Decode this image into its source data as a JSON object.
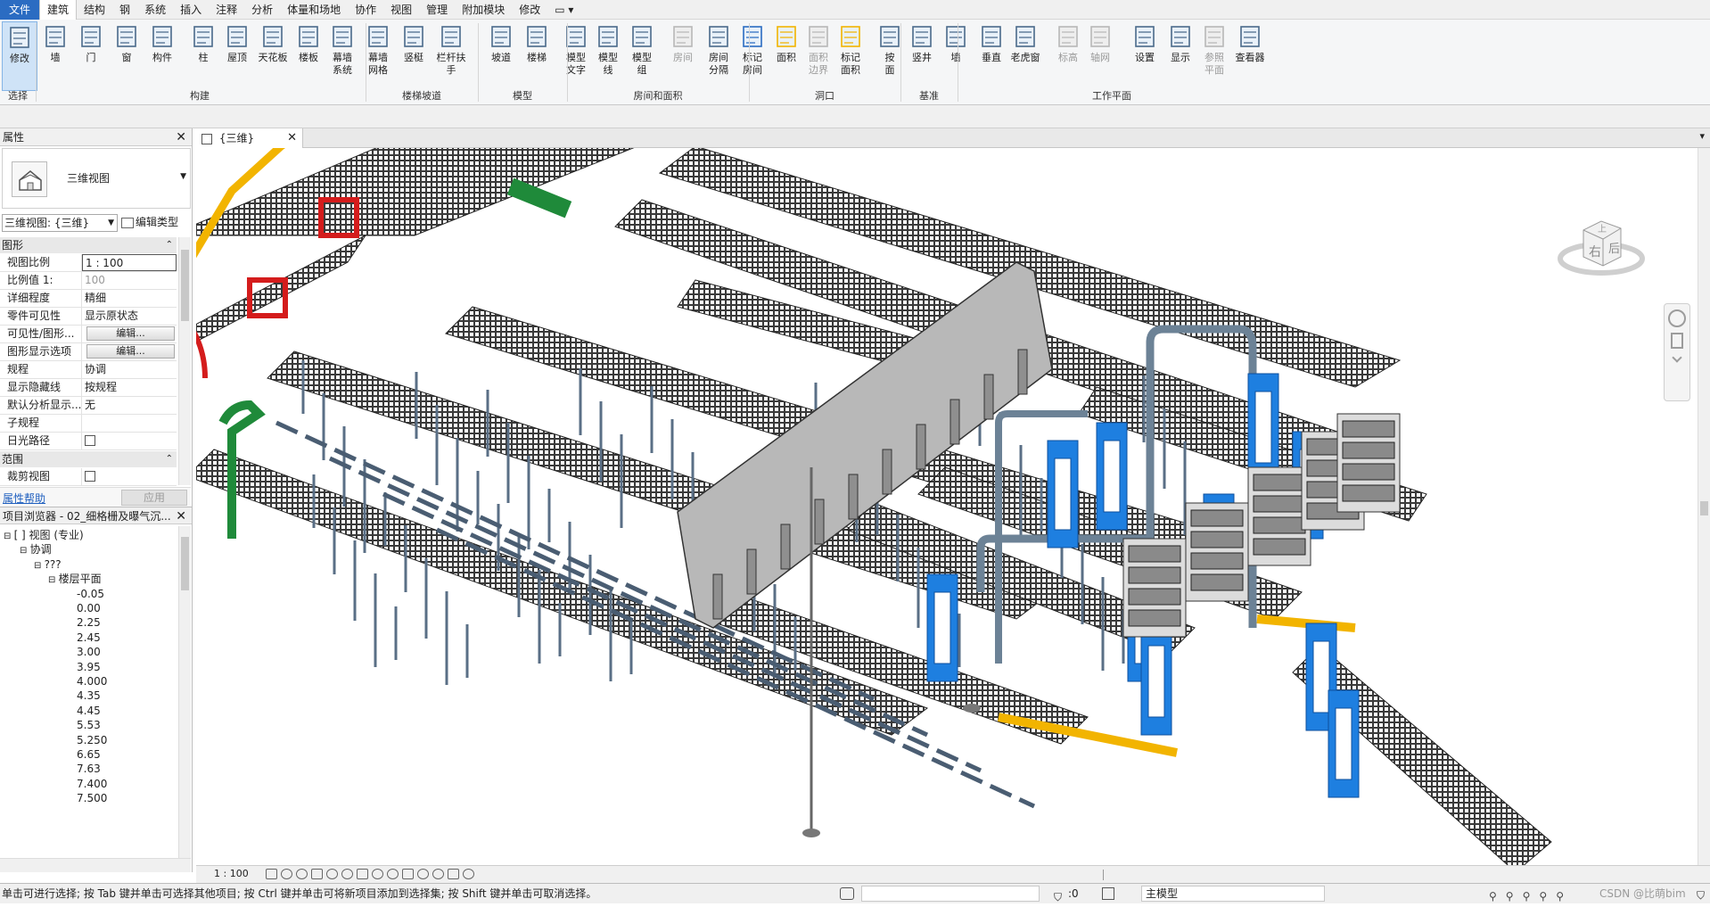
{
  "menubar": {
    "items": [
      "文件",
      "建筑",
      "结构",
      "钢",
      "系统",
      "插入",
      "注释",
      "分析",
      "体量和场地",
      "协作",
      "视图",
      "管理",
      "附加模块",
      "修改"
    ],
    "active_index": 1,
    "extra_dropdown": "▭ ▾"
  },
  "ribbon": {
    "buttons": [
      {
        "label": "修改",
        "icon": "cursor-arrow-icon",
        "active": true
      },
      {
        "label": "墙",
        "icon": "wall-icon"
      },
      {
        "label": "门",
        "icon": "door-icon"
      },
      {
        "label": "窗",
        "icon": "window-icon"
      },
      {
        "label": "构件",
        "icon": "component-icon"
      },
      {
        "label": "柱",
        "icon": "column-icon"
      },
      {
        "label": "屋顶",
        "icon": "roof-icon"
      },
      {
        "label": "天花板",
        "icon": "ceiling-icon"
      },
      {
        "label": "楼板",
        "icon": "floor-icon"
      },
      {
        "label": "幕墙\n系统",
        "icon": "curtain-system-icon"
      },
      {
        "label": "幕墙\n网格",
        "icon": "curtain-grid-icon"
      },
      {
        "label": "竖梃",
        "icon": "mullion-icon"
      },
      {
        "label": "栏杆扶手",
        "icon": "railing-icon"
      },
      {
        "label": "坡道",
        "icon": "ramp-icon"
      },
      {
        "label": "楼梯",
        "icon": "stair-icon"
      },
      {
        "label": "模型\n文字",
        "icon": "model-text-icon"
      },
      {
        "label": "模型\n线",
        "icon": "model-line-icon"
      },
      {
        "label": "模型\n组",
        "icon": "model-group-icon"
      },
      {
        "label": "房间",
        "icon": "room-icon",
        "dim": true
      },
      {
        "label": "房间\n分隔",
        "icon": "room-separator-icon"
      },
      {
        "label": "标记\n房间",
        "icon": "tag-room-icon"
      },
      {
        "label": "面积",
        "icon": "area-icon"
      },
      {
        "label": "面积\n边界",
        "icon": "area-boundary-icon",
        "dim": true
      },
      {
        "label": "标记\n面积",
        "icon": "tag-area-icon"
      },
      {
        "label": "按\n面",
        "icon": "by-face-icon"
      },
      {
        "label": "竖井",
        "icon": "shaft-icon"
      },
      {
        "label": "墙",
        "icon": "wall-opening-icon"
      },
      {
        "label": "垂直",
        "icon": "vertical-opening-icon"
      },
      {
        "label": "老虎窗",
        "icon": "dormer-icon"
      },
      {
        "label": "标高",
        "icon": "level-icon",
        "dim": true
      },
      {
        "label": "轴网",
        "icon": "grid-icon",
        "dim": true
      },
      {
        "label": "设置",
        "icon": "set-workplane-icon"
      },
      {
        "label": "显示",
        "icon": "show-workplane-icon"
      },
      {
        "label": "参照\n平面",
        "icon": "ref-plane-icon",
        "dim": true
      },
      {
        "label": "查看器",
        "icon": "viewer-icon"
      }
    ],
    "groups": [
      "选择",
      "构建",
      "楼梯坡道",
      "模型",
      "房间和面积",
      "洞口",
      "基准",
      "工作平面"
    ]
  },
  "properties": {
    "title": "属性",
    "type_name": "三维视图",
    "view_selector": "三维视图: {三维}",
    "edit_type": "编辑类型",
    "section_graphics": "图形",
    "rows": [
      {
        "k": "视图比例",
        "v": "1 : 100"
      },
      {
        "k": "比例值 1:",
        "v": "100"
      },
      {
        "k": "详细程度",
        "v": "精细"
      },
      {
        "k": "零件可见性",
        "v": "显示原状态"
      },
      {
        "k": "可见性/图形...",
        "v": "编辑..."
      },
      {
        "k": "图形显示选项",
        "v": "编辑..."
      },
      {
        "k": "规程",
        "v": "协调"
      },
      {
        "k": "显示隐藏线",
        "v": "按规程"
      },
      {
        "k": "默认分析显示...",
        "v": "无"
      },
      {
        "k": "子规程",
        "v": ""
      },
      {
        "k": "日光路径",
        "v": ""
      }
    ],
    "section_extents": "范围",
    "crop_row": "裁剪视图",
    "help": "属性帮助",
    "apply": "应用"
  },
  "browser": {
    "title": "项目浏览器 - 02_细格栅及曝气沉...",
    "tree": [
      {
        "label": "[ ] 视图 (专业)",
        "level": 0
      },
      {
        "label": "协调",
        "level": 1
      },
      {
        "label": "???",
        "level": 2
      },
      {
        "label": "楼层平面",
        "level": 3
      },
      {
        "label": "-0.05",
        "level": 4
      },
      {
        "label": "0.00",
        "level": 4
      },
      {
        "label": "2.25",
        "level": 4
      },
      {
        "label": "2.45",
        "level": 4
      },
      {
        "label": "3.00",
        "level": 4
      },
      {
        "label": "3.95",
        "level": 4
      },
      {
        "label": "4.000",
        "level": 4
      },
      {
        "label": "4.35",
        "level": 4
      },
      {
        "label": "4.45",
        "level": 4
      },
      {
        "label": "5.53",
        "level": 4
      },
      {
        "label": "5.250",
        "level": 4
      },
      {
        "label": "6.65",
        "level": 4
      },
      {
        "label": "7.63",
        "level": 4
      },
      {
        "label": "7.400",
        "level": 4
      },
      {
        "label": "7.500",
        "level": 4
      }
    ]
  },
  "viewtab": {
    "label": "{三维}"
  },
  "viewcube": {
    "face_front": "右",
    "face_right": "后",
    "face_top": "上"
  },
  "viewbar": {
    "scale": "1 : 100"
  },
  "status": {
    "message": "单击可进行选择; 按 Tab 键并单击可选择其他项目; 按 Ctrl 键并单击可将新项目添加到选择集; 按 Shift 键并单击可取消选择。",
    "coord": ":0",
    "model": "主模型",
    "watermark": "CSDN @比萌bim"
  },
  "colors": {
    "accent": "#2b6cc2",
    "grating": "#2f2f2f",
    "blue_gate": "#1e7fe0",
    "yellow_pipe": "#f2b400",
    "green_equipment": "#1f8a3a",
    "red_frame": "#d41c1c"
  }
}
